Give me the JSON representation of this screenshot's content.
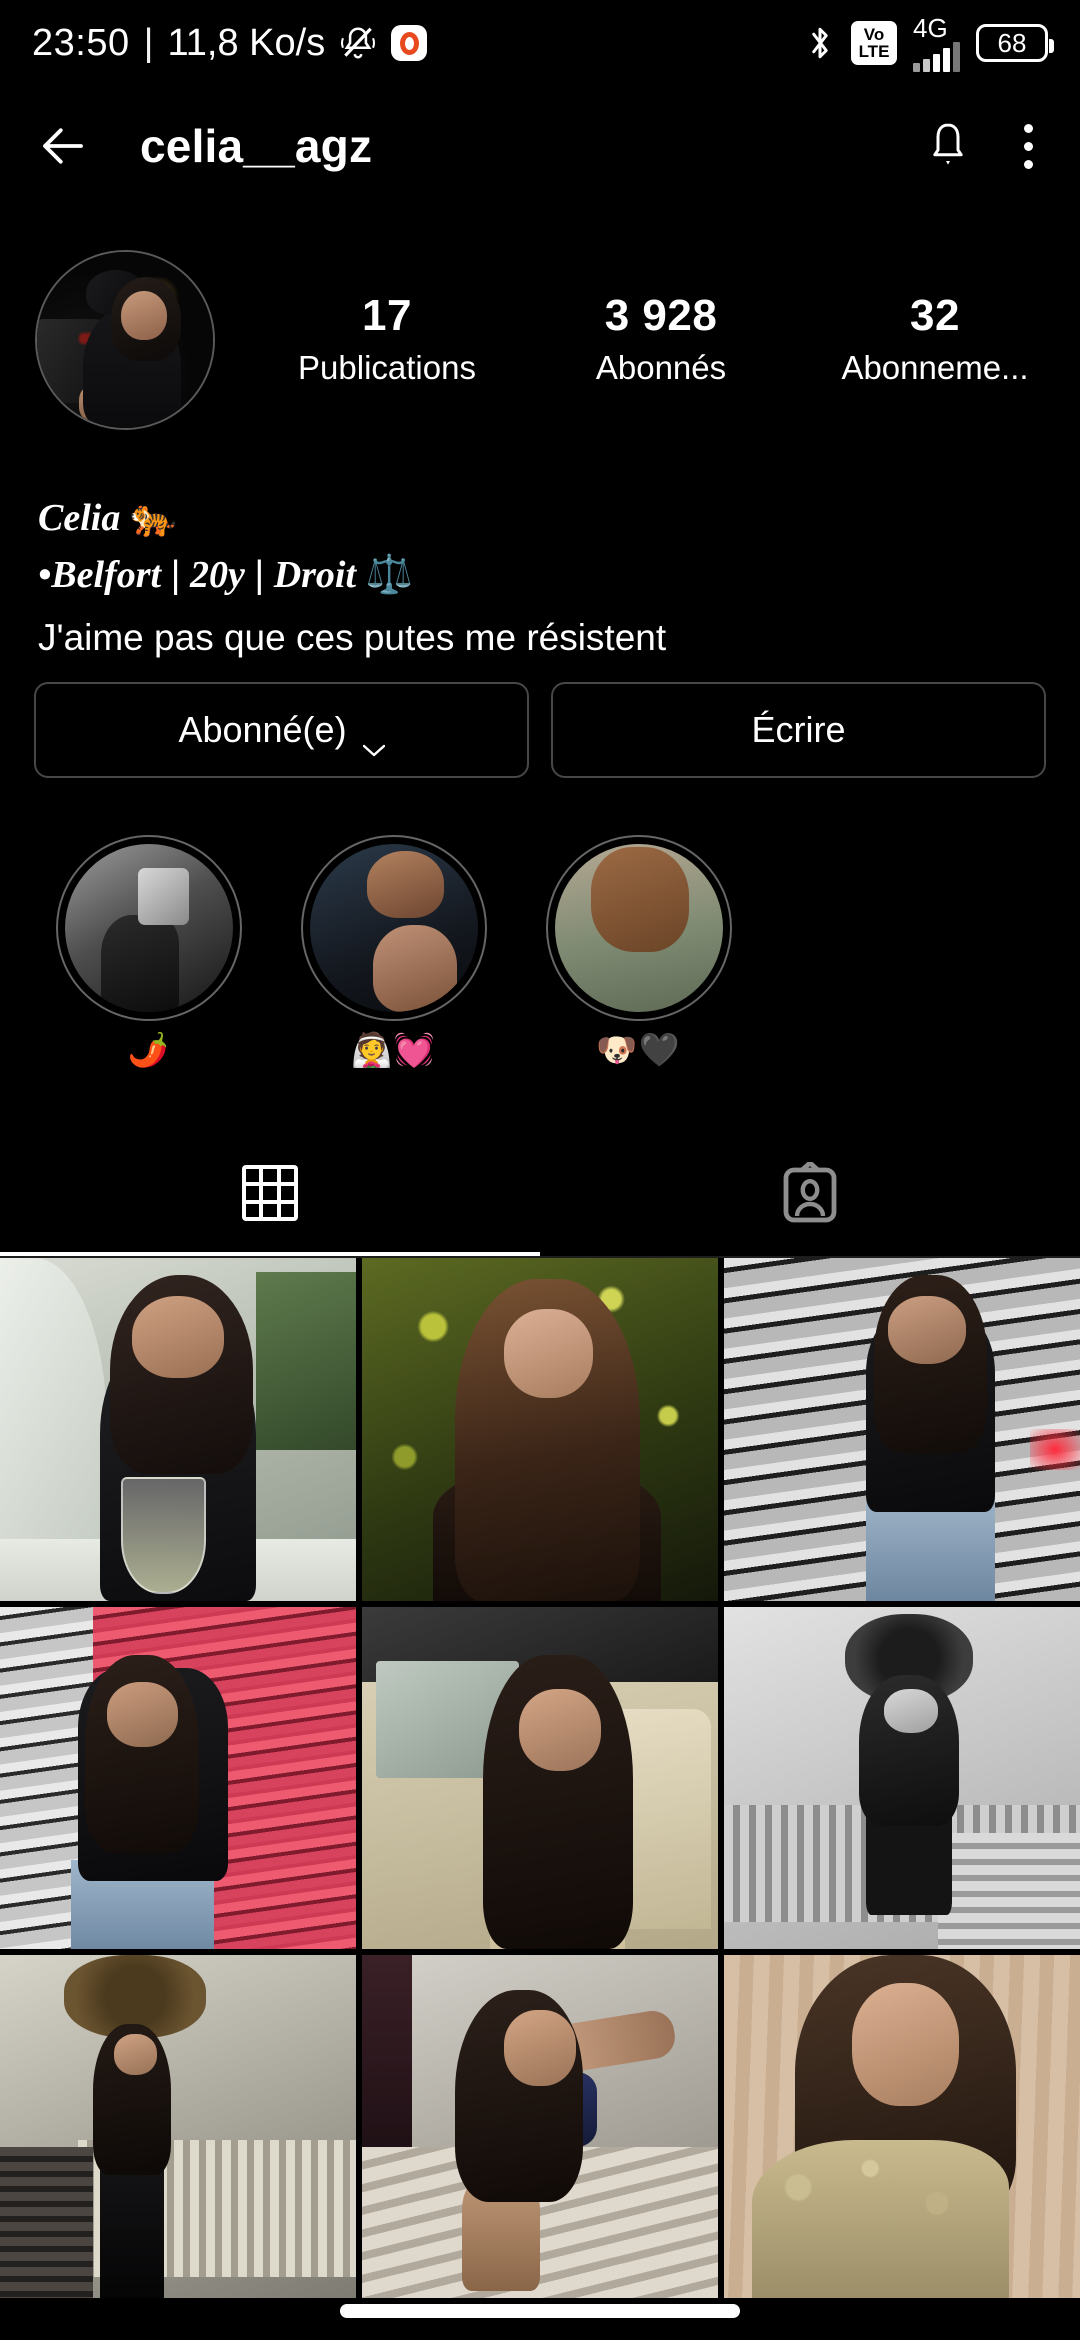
{
  "status_bar": {
    "clock": "23:50",
    "separator": "|",
    "network_speed": "11,8 Ko/s",
    "mute_icon": "bell-slash-icon",
    "record_icon": "screen-record-icon",
    "bluetooth_icon": "bluetooth-icon",
    "volte_top": "Vo",
    "volte_bottom": "LTE",
    "network_type": "4G",
    "battery_level": "68"
  },
  "header": {
    "back_icon": "back-arrow-icon",
    "username": "celia__agz",
    "notify_icon": "bell-icon",
    "menu_icon": "more-options-icon"
  },
  "profile": {
    "avatar_label": "profile-picture",
    "stats": [
      {
        "value": "17",
        "label": "Publications"
      },
      {
        "value": "3 928",
        "label": "Abonnés"
      },
      {
        "value": "32",
        "label": "Abonneme..."
      }
    ]
  },
  "bio": {
    "name": "Celia",
    "name_emoji": "🐅",
    "location": "•Belfort",
    "divider1": "|",
    "age": "20y",
    "divider2": "|",
    "study": "Droit",
    "study_emoji": "⚖️",
    "line": "J'aime pas que ces putes me résistent"
  },
  "actions": {
    "follow_label": "Abonné(e)",
    "follow_chevron": "chevron-down-icon",
    "message_label": "Écrire"
  },
  "highlights": [
    {
      "label": "🌶️",
      "name": "highlight-chili"
    },
    {
      "label": "👰💓",
      "name": "highlight-bride-heart"
    },
    {
      "label": "🐶🖤",
      "name": "highlight-dog-heart"
    }
  ],
  "tabs": [
    {
      "name": "tab-grid",
      "icon": "grid-icon",
      "active": true
    },
    {
      "name": "tab-tagged",
      "icon": "tagged-person-icon",
      "active": false
    }
  ],
  "posts": [
    {
      "name": "post-1",
      "alt": "woman in black top at cafe with wine glass"
    },
    {
      "name": "post-2",
      "alt": "woman with golden foliage background"
    },
    {
      "name": "post-3",
      "alt": "woman posing by striped garage door"
    },
    {
      "name": "post-4",
      "alt": "woman against pink striped wall"
    },
    {
      "name": "post-5",
      "alt": "woman in cream car interior"
    },
    {
      "name": "post-6",
      "alt": "black and white staircase portrait"
    },
    {
      "name": "post-7",
      "alt": "woman in green corset on staircase"
    },
    {
      "name": "post-8",
      "alt": "woman leaning on stairs"
    },
    {
      "name": "post-9",
      "alt": "woman in fur coat portrait"
    }
  ],
  "nav": {
    "pill": "home-indicator"
  },
  "colors": {
    "background": "#000000",
    "text": "#ffffff",
    "border": "#474747",
    "accent_record": "#e8491f"
  }
}
